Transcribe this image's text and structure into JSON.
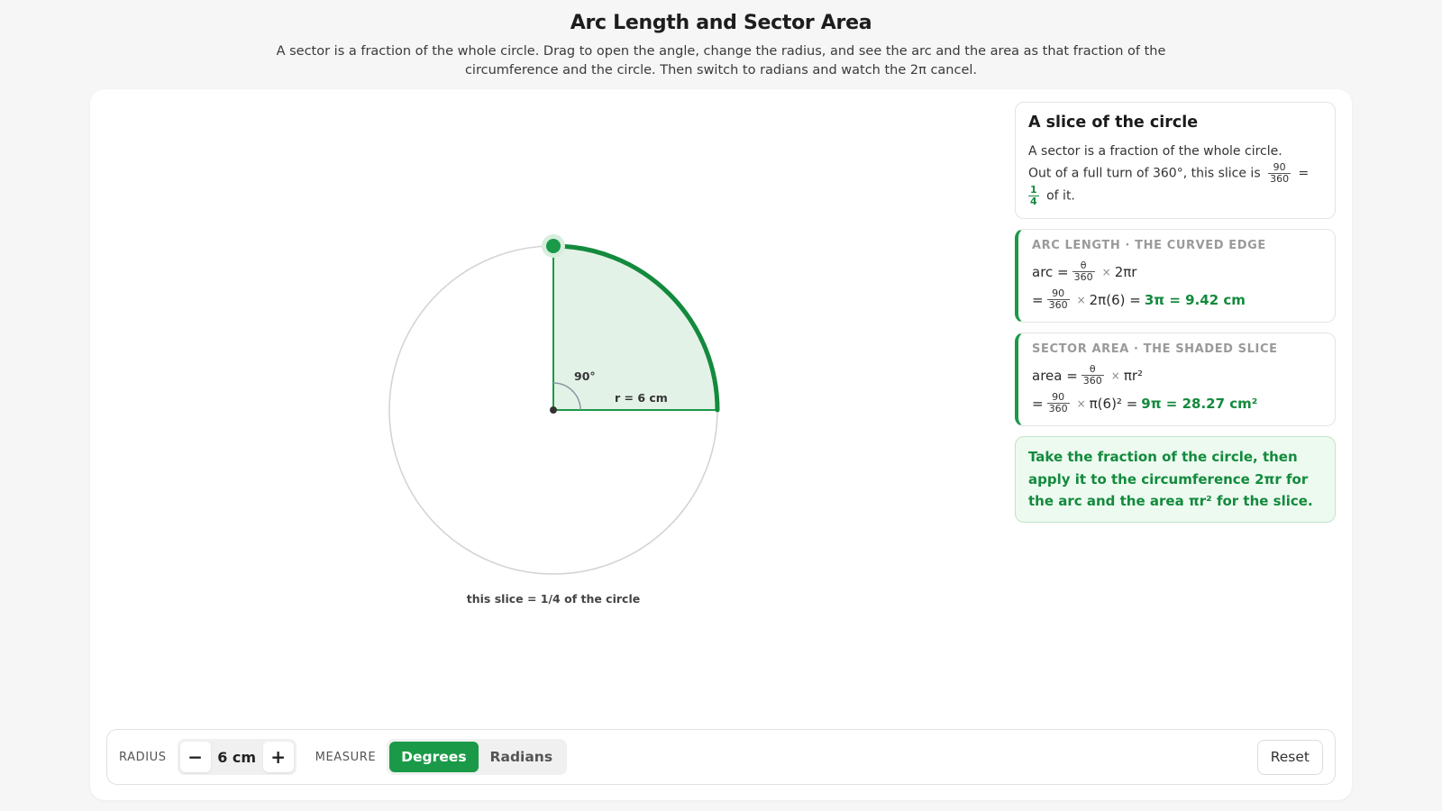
{
  "header": {
    "title": "Arc Length and Sector Area",
    "description": "A sector is a fraction of the whole circle. Drag to open the angle, change the radius, and see the arc and the area as that fraction of the circumference and the circle. Then switch to radians and watch the 2π cancel."
  },
  "diagram": {
    "angle_deg": 90,
    "radius_cm": 6,
    "angle_label": "90°",
    "radius_label": "r = 6 cm",
    "caption": "this slice = 1/4 of the circle"
  },
  "panel": {
    "intro": {
      "title": "A slice of the circle",
      "line1": "A sector is a fraction of the whole circle.",
      "line2_prefix": "Out of a full turn of 360°, this slice is",
      "frac1_num": "90",
      "frac1_den": "360",
      "equals": "=",
      "frac2_num": "1",
      "frac2_den": "4",
      "line2_suffix": "of it."
    },
    "arc": {
      "heading": "ARC LENGTH · THE CURVED EDGE",
      "l1_prefix": "arc =",
      "theta": "θ",
      "den": "360",
      "times": "×",
      "l1_suffix": "2πr",
      "l2_prefix": "=",
      "num": "90",
      "l2_mid": "2π(6) =",
      "l2_result": "3π = 9.42 cm"
    },
    "area": {
      "heading": "SECTOR AREA · THE SHADED SLICE",
      "l1_prefix": "area =",
      "theta": "θ",
      "den": "360",
      "times": "×",
      "l1_suffix": "πr²",
      "l2_prefix": "=",
      "num": "90",
      "l2_mid": "π(6)² =",
      "l2_result": "9π = 28.27 cm²"
    },
    "takeaway": "Take the fraction of the circle, then apply it to the circumference 2πr for the arc and the area πr² for the slice."
  },
  "toolbar": {
    "radius_label": "RADIUS",
    "minus": "−",
    "radius_value": "6 cm",
    "plus": "+",
    "measure_label": "MEASURE",
    "degrees": "Degrees",
    "radians": "Radians",
    "active_measure": "Degrees",
    "reset": "Reset"
  },
  "colors": {
    "accent": "#1a9a48",
    "arc": "#138a3d",
    "sector_fill": "#e3f2e7",
    "takeaway_bg": "#edfaf0"
  }
}
